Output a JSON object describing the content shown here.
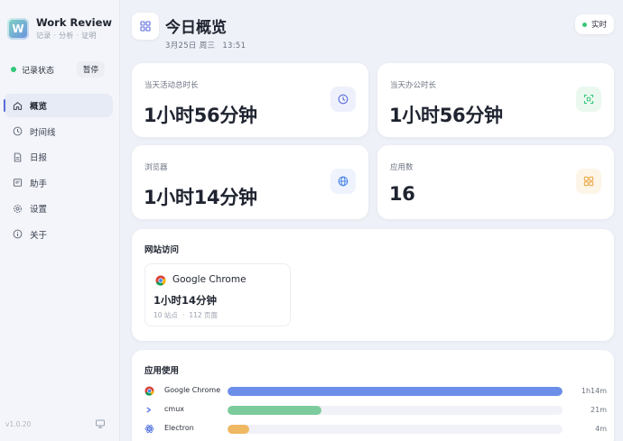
{
  "brand": {
    "title": "Work Review",
    "subtitle": "记录 · 分析 · 证明",
    "logo_letter": "W"
  },
  "record_status": {
    "label": "记录状态",
    "pause_label": "暂停",
    "status_color": "#34c77b"
  },
  "nav": [
    {
      "label": "概览",
      "icon": "home-icon",
      "active": true
    },
    {
      "label": "时间线",
      "icon": "clock-icon",
      "active": false
    },
    {
      "label": "日报",
      "icon": "document-icon",
      "active": false
    },
    {
      "label": "助手",
      "icon": "assistant-icon",
      "active": false
    },
    {
      "label": "设置",
      "icon": "gear-icon",
      "active": false
    },
    {
      "label": "关于",
      "icon": "info-icon",
      "active": false
    }
  ],
  "version": "v1.0.20",
  "header": {
    "title": "今日概览",
    "date": "3月25日 周三",
    "time": "13:51",
    "realtime_label": "实时"
  },
  "stats": [
    {
      "label": "当天活动总时长",
      "value": "1小时56分钟",
      "icon": "clock-icon",
      "accent": "#5b6bdc",
      "bg": "#eef1fb"
    },
    {
      "label": "当天办公时长",
      "value": "1小时56分钟",
      "icon": "focus-icon",
      "accent": "#34c77b",
      "bg": "#eaf8f0"
    },
    {
      "label": "浏览器",
      "value": "1小时14分钟",
      "icon": "globe-icon",
      "accent": "#4a86e8",
      "bg": "#eef3fd"
    },
    {
      "label": "应用数",
      "value": "16",
      "icon": "apps-grid-icon",
      "accent": "#e8a23a",
      "bg": "#fdf5e8"
    }
  ],
  "website_section": {
    "title": "网站访问",
    "sites": [
      {
        "name": "Google Chrome",
        "duration": "1小时14分钟",
        "sites_count": "10 站点",
        "pages_count": "112 页面"
      }
    ]
  },
  "apps_section": {
    "title": "应用使用",
    "apps": [
      {
        "name": "Google Chrome",
        "duration": "1h14m",
        "share": 1.0,
        "color": "#6b8fe8",
        "icon": "chrome-icon"
      },
      {
        "name": "cmux",
        "duration": "21m",
        "share": 0.28,
        "color": "#7ccb9c",
        "icon": "terminal-icon"
      },
      {
        "name": "Electron",
        "duration": "4m",
        "share": 0.065,
        "color": "#efb862",
        "icon": "electron-icon"
      }
    ]
  }
}
